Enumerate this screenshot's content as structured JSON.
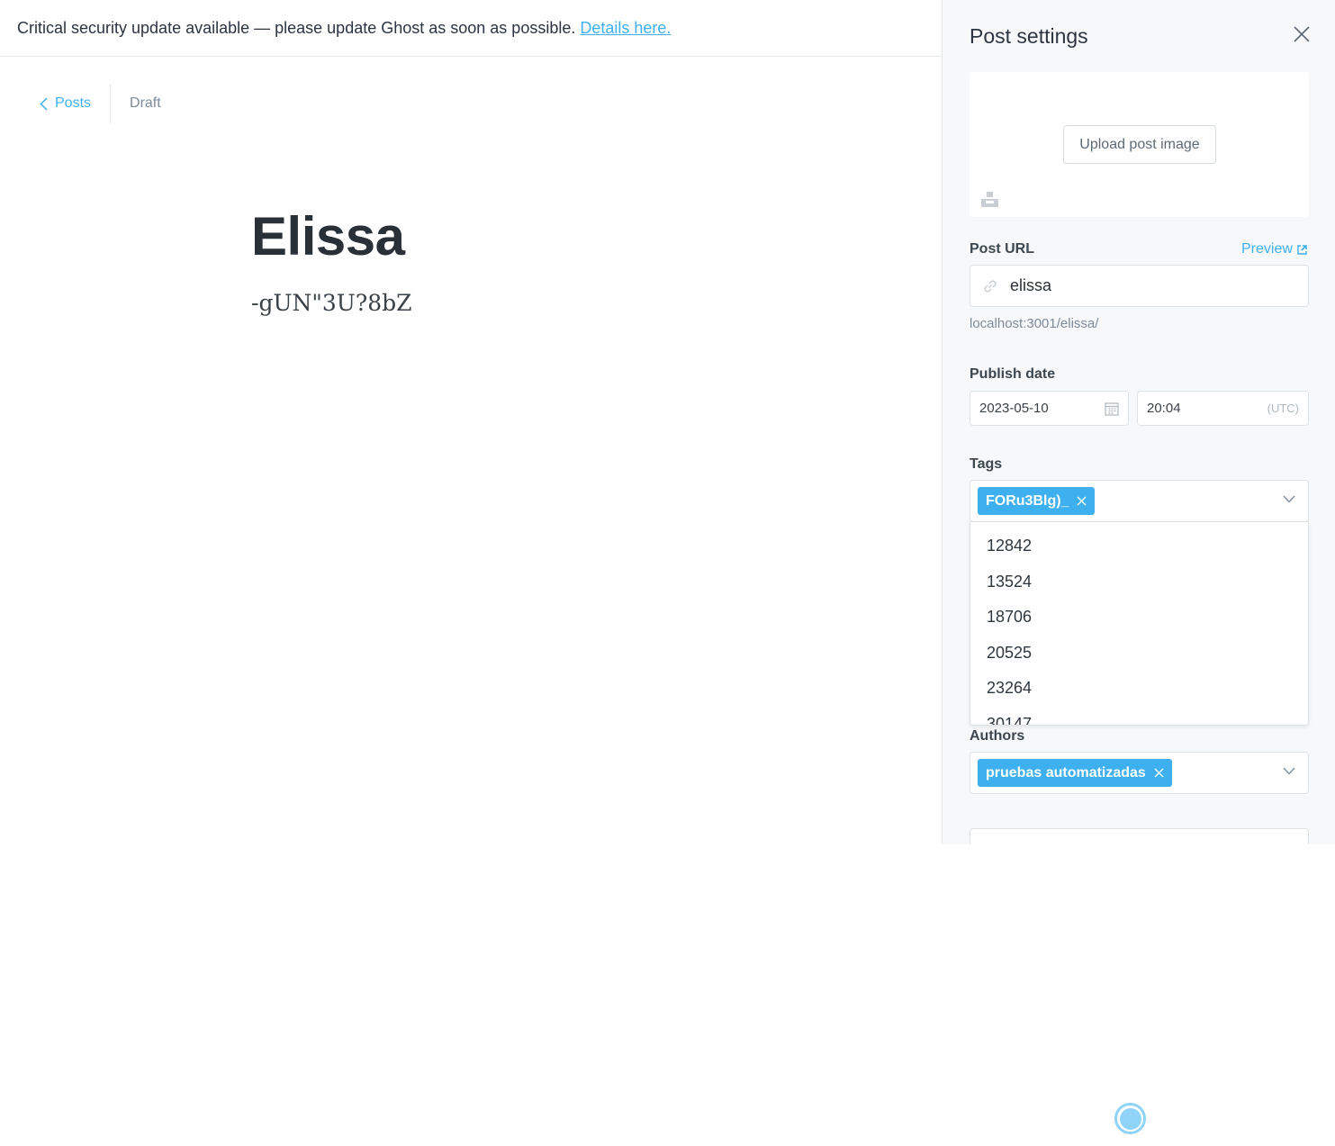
{
  "banner": {
    "message": "Critical security update available — please update Ghost as soon as possible.",
    "link_label": "Details here."
  },
  "breadcrumb": {
    "back_label": "Posts",
    "status": "Draft"
  },
  "post": {
    "title": "Elissa",
    "body": "-gUN\"3U?8bZ"
  },
  "settings": {
    "title": "Post settings",
    "upload_label": "Upload post image",
    "post_url_label": "Post URL",
    "preview_label": "Preview",
    "slug": "elissa",
    "url_hint": "localhost:3001/elissa/",
    "publish_date_label": "Publish date",
    "date": "2023-05-10",
    "time": "20:04",
    "timezone": "(UTC)",
    "tags_label": "Tags",
    "tags": [
      "FORu3Blg)_"
    ],
    "tag_options": [
      "12842",
      "13524",
      "18706",
      "20525",
      "23264",
      "30147"
    ],
    "authors_label": "Authors",
    "authors": [
      "pruebas automatizadas"
    ]
  },
  "colors": {
    "accent": "#3eb0ef",
    "panel_bg": "#f7f8fa"
  }
}
